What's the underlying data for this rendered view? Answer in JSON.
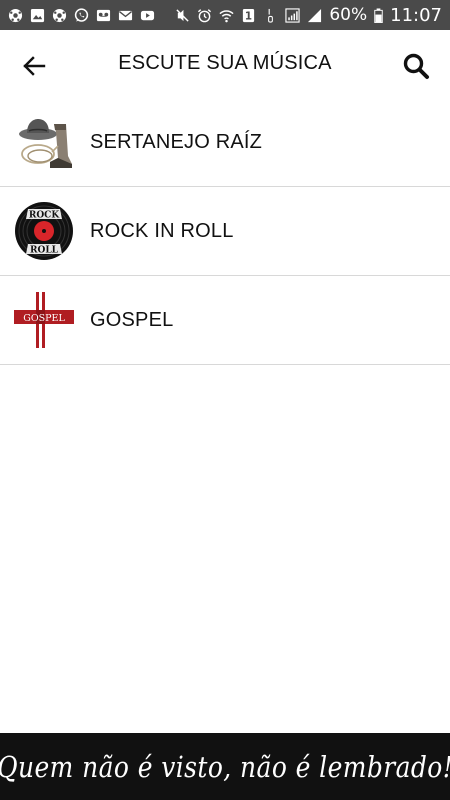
{
  "status_bar": {
    "battery": "60%",
    "time": "11:07",
    "sim_slot": "1"
  },
  "app_bar": {
    "title": "ESCUTE SUA MÚSICA"
  },
  "genres": [
    {
      "label": "SERTANEJO RAÍZ",
      "icon": "cowboy-hat-icon"
    },
    {
      "label": "ROCK IN ROLL",
      "icon": "rock-roll-record-icon",
      "thumb_text_top": "ROCK",
      "thumb_text_bottom": "ROLL"
    },
    {
      "label": "GOSPEL",
      "icon": "gospel-cross-icon",
      "thumb_text": "GOSPEL"
    }
  ],
  "banner": {
    "text": "Quem não é visto, não é lembrado!"
  },
  "colors": {
    "status_bar_bg": "#4a4a4a",
    "banner_bg": "#111111",
    "gospel_red": "#b01d22",
    "record_red": "#d9252a"
  }
}
